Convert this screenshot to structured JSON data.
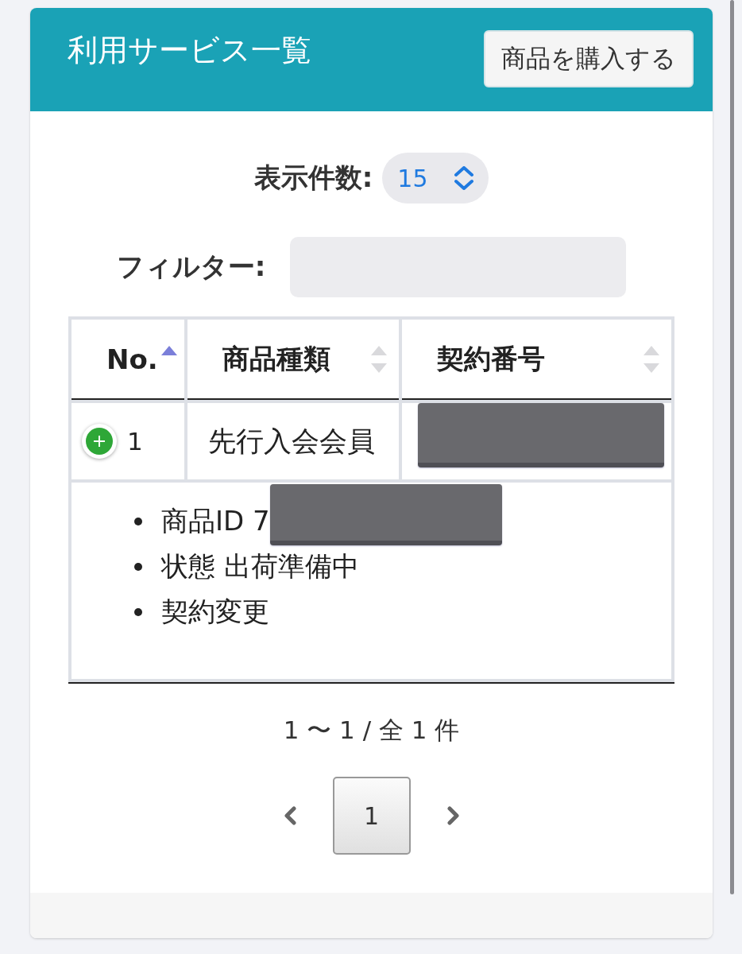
{
  "header": {
    "title": "利用サービス一覧",
    "action_button": "商品を購入する"
  },
  "page_size": {
    "label": "表示件数:",
    "value": "15"
  },
  "filter": {
    "label": "フィルター:"
  },
  "table": {
    "columns": [
      {
        "label": "No.",
        "sorted": true
      },
      {
        "label": "商品種類",
        "sorted": false
      },
      {
        "label": "契約番号",
        "sorted": false
      }
    ],
    "rows": [
      {
        "no": "1",
        "product_type": "先行入会会員",
        "contract_number_redacted": true,
        "details": [
          {
            "text": "商品ID 7",
            "redacted": true
          },
          {
            "text": "状態 出荷準備中",
            "redacted": false
          },
          {
            "text": "契約変更",
            "redacted": false
          }
        ]
      }
    ]
  },
  "pagination": {
    "summary": "1 〜 1 / 全 1 件",
    "pages": [
      {
        "label": "1",
        "selected": true
      }
    ]
  }
}
